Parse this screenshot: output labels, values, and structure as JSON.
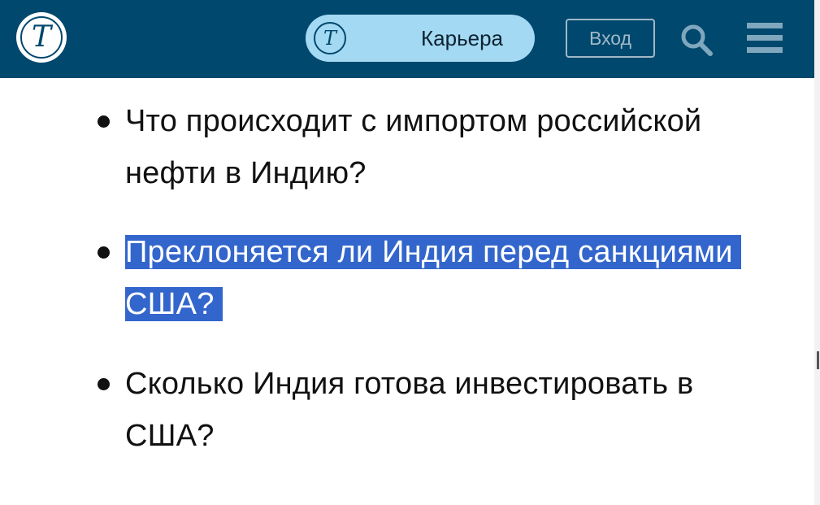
{
  "header": {
    "background_color": "#00486d",
    "logo_icon": "times-logo-icon",
    "logo_glyph": "T",
    "career_button": {
      "label": "Карьера",
      "icon_glyph": "T",
      "background_color": "#a3d9f2"
    },
    "login_label": "Вход",
    "search_icon": "search-icon",
    "menu_icon": "hamburger-menu-icon"
  },
  "article": {
    "items": [
      {
        "text": "Что происходит с импортом российской нефти в Индию?",
        "selected": false
      },
      {
        "text": "Преклоняется ли Индия перед санкциями США?",
        "selected": true
      },
      {
        "text": "Сколько Индия готова инвестировать в США?",
        "selected": false
      }
    ],
    "selection_color": "#3366cc"
  }
}
